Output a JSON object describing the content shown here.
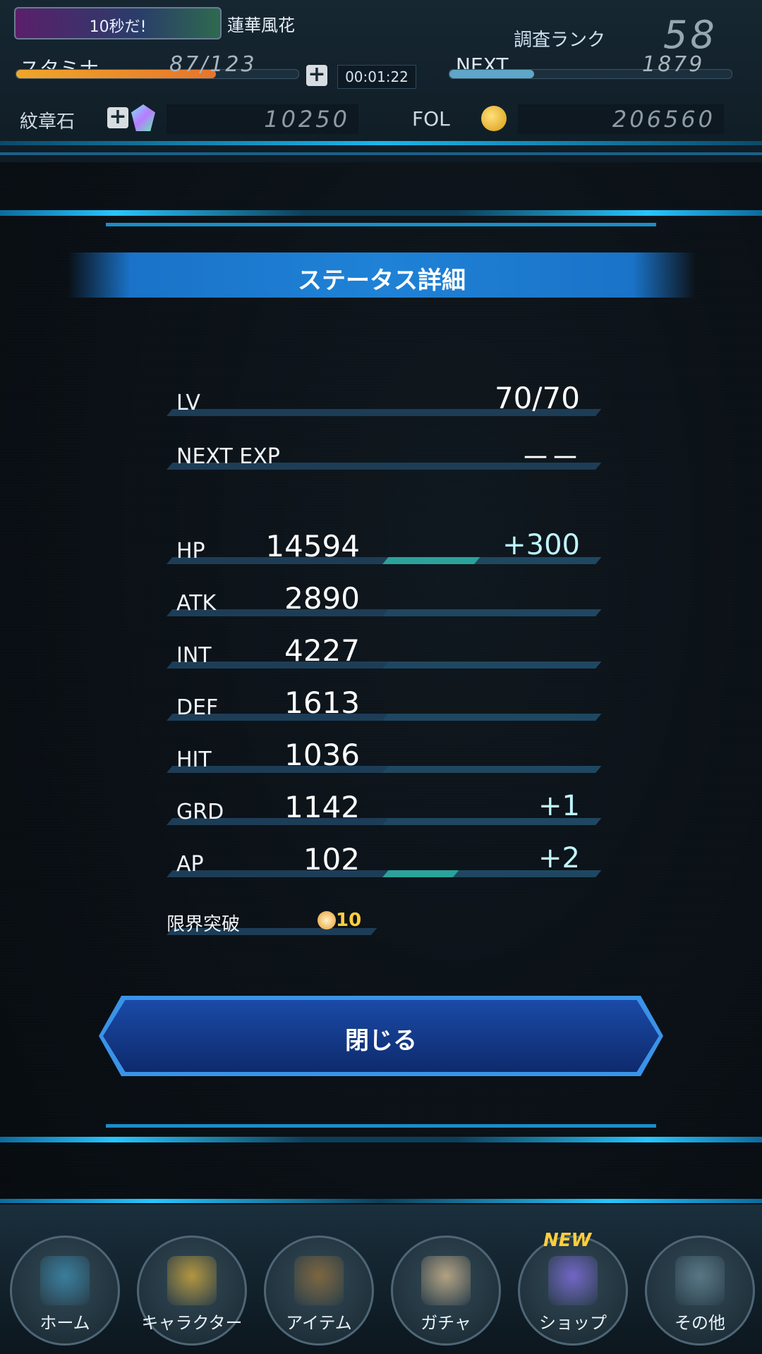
{
  "hud": {
    "event_badge": "10秒だ!",
    "player_name": "蓮華風花",
    "rank_label": "調査ランク",
    "rank_value": "58",
    "stamina_label": "スタミナ",
    "stamina_value": "87/123",
    "stamina_fraction": 0.707,
    "stamina_timer": "00:01:22",
    "next_label": "NEXT",
    "next_value": "1879",
    "next_fraction": 0.3,
    "crest_label": "紋章石",
    "crest_value": "10250",
    "fol_label": "FOL",
    "fol_value": "206560"
  },
  "modal": {
    "title": "ステータス詳細",
    "lv_label": "LV",
    "lv_value": "70/70",
    "next_exp_label": "NEXT EXP",
    "next_exp_value": "－－",
    "stats": [
      {
        "label": "HP",
        "value": "14594",
        "bonus": "+300",
        "bonus_fraction": 0.43
      },
      {
        "label": "ATK",
        "value": "2890",
        "bonus": "",
        "bonus_fraction": 0
      },
      {
        "label": "INT",
        "value": "4227",
        "bonus": "",
        "bonus_fraction": 0
      },
      {
        "label": "DEF",
        "value": "1613",
        "bonus": "",
        "bonus_fraction": 0
      },
      {
        "label": "HIT",
        "value": "1036",
        "bonus": "",
        "bonus_fraction": 0
      },
      {
        "label": "GRD",
        "value": "1142",
        "bonus": "+1",
        "bonus_fraction": 0.0
      },
      {
        "label": "AP",
        "value": "102",
        "bonus": "+2",
        "bonus_fraction": 0.33
      }
    ],
    "limit_break_label": "限界突破",
    "limit_break_value": "10",
    "close_label": "閉じる"
  },
  "nav": {
    "items": [
      {
        "label": "ホーム",
        "icon": "home-door-icon"
      },
      {
        "label": "キャラクター",
        "icon": "characters-icon"
      },
      {
        "label": "アイテム",
        "icon": "item-bag-icon"
      },
      {
        "label": "ガチャ",
        "icon": "gacha-icon"
      },
      {
        "label": "ショップ",
        "icon": "shop-crystal-icon"
      },
      {
        "label": "その他",
        "icon": "gear-icon"
      }
    ],
    "shop_badge": "NEW"
  },
  "colors": {
    "accent": "#27c6ff",
    "title_band": "#1f82d6",
    "bonus_fill": "#2aa39b",
    "stamina": "#f0a62a"
  }
}
